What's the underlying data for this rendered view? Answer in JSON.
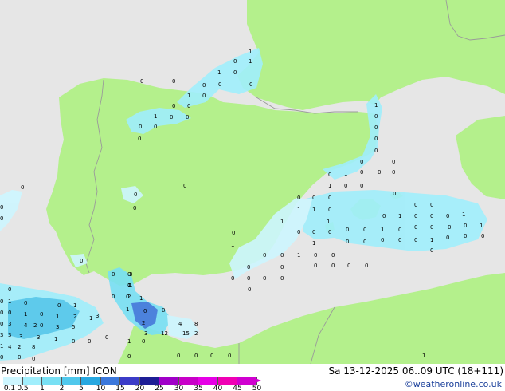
{
  "colors": {
    "land": "#b4f08c",
    "sea": "#e6e6e6",
    "border": "#9a9a9a",
    "credit": "#1a3f9a"
  },
  "footer": {
    "title": "Precipitation [mm]  ICON",
    "datetime": "Sa 13-12-2025 06..09 UTC (18+111)",
    "credit": "©weatheronline.co.uk"
  },
  "legend": {
    "labels": [
      "0.1",
      "0.5",
      "1",
      "2",
      "5",
      "10",
      "15",
      "20",
      "25",
      "30",
      "35",
      "40",
      "45",
      "50"
    ],
    "colors": [
      "#ffffff",
      "#cdf6ff",
      "#a0eefc",
      "#78e0f4",
      "#50c8ec",
      "#28a8e0",
      "#3c78dc",
      "#3c3cc8",
      "#1e1e96",
      "#a000c8",
      "#c800c8",
      "#e600e6",
      "#f000b4",
      "#d000d0"
    ]
  },
  "map": {
    "precip_values": [
      "1",
      "0",
      "1",
      "0",
      "1",
      "0",
      "0",
      "0",
      "0",
      "1",
      "0",
      "0",
      "0",
      "0",
      "1",
      "0",
      "0",
      "0",
      "0",
      "0",
      "1",
      "0",
      "0",
      "0",
      "0",
      "0",
      "1",
      "0",
      "0",
      "0",
      "0",
      "0",
      "1",
      "0",
      "0",
      "0",
      "0",
      "0",
      "0",
      "0",
      "1",
      "1",
      "0",
      "0",
      "0",
      "0",
      "0",
      "0",
      "0",
      "0",
      "1",
      "0",
      "1",
      "0",
      "0",
      "0",
      "1",
      "1",
      "0",
      "0",
      "0",
      "0",
      "0",
      "0",
      "1",
      "0",
      "0",
      "0",
      "0",
      "0",
      "1",
      "0",
      "0",
      "0",
      "1",
      "0",
      "0",
      "0",
      "0",
      "0",
      "1",
      "1",
      "0",
      "1",
      "0",
      "0",
      "0",
      "0",
      "0",
      "0",
      "0",
      "0",
      "0",
      "0",
      "0",
      "0",
      "0",
      "0",
      "0",
      "0",
      "0",
      "0",
      "0",
      "0",
      "0",
      "0",
      "1",
      "0",
      "0",
      "0",
      "0",
      "1",
      "0",
      "0",
      "0",
      "0",
      "0",
      "0",
      "0",
      "1",
      "0",
      "0",
      "0",
      "0",
      "1",
      "0",
      "1",
      "2",
      "1",
      "3",
      "4",
      "5",
      "3",
      "3",
      "3",
      "1",
      "3",
      "3",
      "1",
      "2",
      "4",
      "8",
      "2",
      "2",
      "3",
      "3",
      "1",
      "1",
      "1",
      "0",
      "0",
      "1",
      "2",
      "3",
      "12",
      "4",
      "8",
      "15",
      "2",
      "1",
      "0",
      "0",
      "0",
      "0",
      "0",
      "0",
      "0",
      "0"
    ]
  }
}
